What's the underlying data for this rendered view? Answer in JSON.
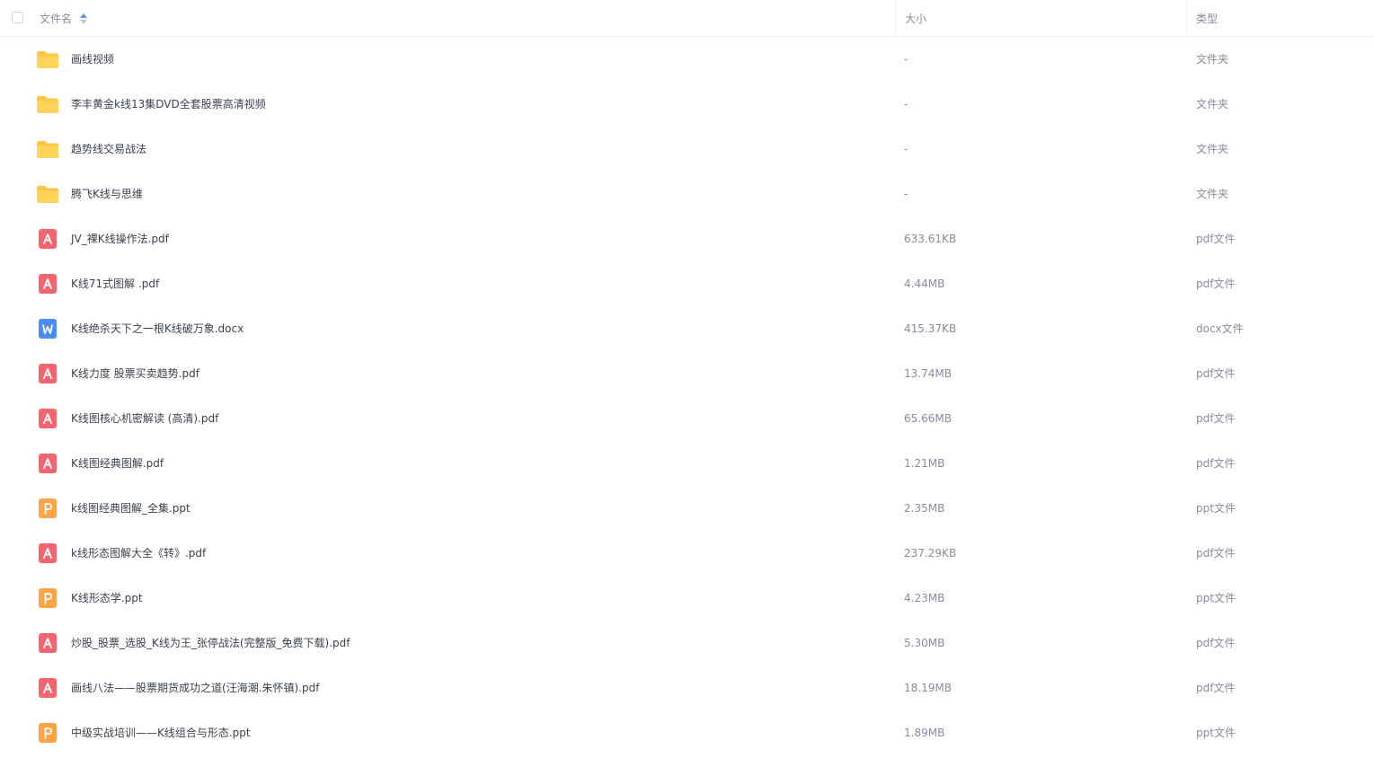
{
  "header": {
    "name_label": "文件名",
    "size_label": "大小",
    "type_label": "类型"
  },
  "files": [
    {
      "name": "画线视频",
      "size": "-",
      "type": "文件夹",
      "icon": "folder"
    },
    {
      "name": "李丰黄金k线13集DVD全套股票高清视频",
      "size": "-",
      "type": "文件夹",
      "icon": "folder"
    },
    {
      "name": "趋势线交易战法",
      "size": "-",
      "type": "文件夹",
      "icon": "folder"
    },
    {
      "name": "腾飞K线与思维",
      "size": "-",
      "type": "文件夹",
      "icon": "folder"
    },
    {
      "name": "JV_裸K线操作法.pdf",
      "size": "633.61KB",
      "type": "pdf文件",
      "icon": "pdf"
    },
    {
      "name": "K线71式图解 .pdf",
      "size": "4.44MB",
      "type": "pdf文件",
      "icon": "pdf"
    },
    {
      "name": "K线绝杀天下之一根K线破万象.docx",
      "size": "415.37KB",
      "type": "docx文件",
      "icon": "docx"
    },
    {
      "name": "K线力度 股票买卖趋势.pdf",
      "size": "13.74MB",
      "type": "pdf文件",
      "icon": "pdf"
    },
    {
      "name": "K线图核心机密解读 (高清).pdf",
      "size": "65.66MB",
      "type": "pdf文件",
      "icon": "pdf"
    },
    {
      "name": "K线图经典图解.pdf",
      "size": "1.21MB",
      "type": "pdf文件",
      "icon": "pdf"
    },
    {
      "name": "k线图经典图解_全集.ppt",
      "size": "2.35MB",
      "type": "ppt文件",
      "icon": "ppt"
    },
    {
      "name": "k线形态图解大全《转》.pdf",
      "size": "237.29KB",
      "type": "pdf文件",
      "icon": "pdf"
    },
    {
      "name": "K线形态学.ppt",
      "size": "4.23MB",
      "type": "ppt文件",
      "icon": "ppt"
    },
    {
      "name": "炒股_股票_选股_K线为王_张停战法(完整版_免费下载).pdf",
      "size": "5.30MB",
      "type": "pdf文件",
      "icon": "pdf"
    },
    {
      "name": "画线八法——股票期货成功之道(汪海潮.朱怀镇).pdf",
      "size": "18.19MB",
      "type": "pdf文件",
      "icon": "pdf"
    },
    {
      "name": "中级实战培训——K线组合与形态.ppt",
      "size": "1.89MB",
      "type": "ppt文件",
      "icon": "ppt"
    }
  ],
  "colors": {
    "folder": "#ffc63f",
    "pdf": "#f5656f",
    "docx": "#4a8cf7",
    "ppt": "#ffa344",
    "sort_active": "#5b8ff9"
  }
}
